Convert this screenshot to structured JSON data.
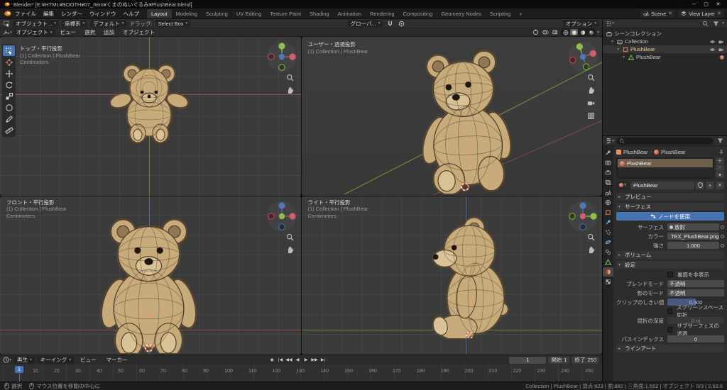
{
  "window": {
    "title": "Blender* [E:¥HTML¥BOOTH¥07_Item¥くまのぬいぐるみ¥PlushBear.blend]"
  },
  "topbar": {
    "menus": [
      "ファイル",
      "編集",
      "レンダー",
      "ウィンドウ",
      "ヘルプ"
    ],
    "workspaces": [
      "Layout",
      "Modeling",
      "Sculpting",
      "UV Editing",
      "Texture Paint",
      "Shading",
      "Animation",
      "Rendering",
      "Compositing",
      "Geometry Nodes",
      "Scripting"
    ],
    "add_workspace": "+",
    "scene": "Scene",
    "view_layer": "View Layer"
  },
  "tool_settings": {
    "mode": "オブジェクト...",
    "coord": "座標系",
    "preset": "デフォルト",
    "drag": "ドラッグ:",
    "tool": "Select Box",
    "orientation": "グローバ...",
    "options": "オプション"
  },
  "viewport_header": {
    "mode": "オブジェクト",
    "menus": [
      "ビュー",
      "選択",
      "追加",
      "オブジェクト"
    ]
  },
  "viewports": {
    "top": {
      "name": "トップ・平行投影",
      "path": "(1) Collection | PlushBear",
      "units": "Centimeters"
    },
    "user": {
      "name": "ユーザー・透視投影",
      "path": "(1) Collection | PlushBear"
    },
    "front": {
      "name": "フロント・平行投影",
      "path": "(1) Collection | PlushBear",
      "units": "Centimeters"
    },
    "right": {
      "name": "ライト・平行投影",
      "path": "(1) Collection | PlushBear",
      "units": "Centimeters"
    }
  },
  "outliner": {
    "rows": [
      {
        "label": "シーンコレクション"
      },
      {
        "label": "Collection"
      },
      {
        "label": "PlushBear"
      },
      {
        "label": "PlushBear"
      }
    ]
  },
  "properties": {
    "breadcrumb": {
      "object": "PlushBear",
      "material": "PlushBear"
    },
    "slot": "PlushBear",
    "datablock": "PlushBear",
    "panels": {
      "preview": "プレビュー",
      "surface": "サーフェス",
      "volume": "ボリューム",
      "settings": "設定",
      "line_art": "ラインアート"
    },
    "surface": {
      "use_nodes": "ノードを使用",
      "surface_label": "サーフェス",
      "surface_value": "放射",
      "color_label": "カラー",
      "color_value": "TEX_PlushBear.png",
      "strength_label": "強さ",
      "strength_value": "1.000"
    },
    "settings": {
      "backface": "裏面を非表示",
      "blend_label": "ブレンドモード",
      "blend_value": "不透明",
      "shadow_label": "影のモード",
      "shadow_value": "不透明",
      "clip_label": "クリップのしきい値",
      "clip_value": "0.500",
      "ssr": "スクリーンスペース屈折",
      "depth_label": "屈折の深度",
      "depth_value": "0 m",
      "sss": "サブサーフェスの透過",
      "pass_label": "パスインデックス",
      "pass_value": "0"
    }
  },
  "timeline": {
    "menus": [
      "再生",
      "キーイング",
      "ビュー",
      "マーカー"
    ],
    "frame": "1",
    "start_label": "開始",
    "start": "1",
    "end_label": "終了",
    "end": "250",
    "ticks": [
      "1",
      "10",
      "20",
      "30",
      "40",
      "50",
      "60",
      "70",
      "80",
      "90",
      "100",
      "110",
      "120",
      "130",
      "140",
      "150",
      "160",
      "170",
      "180",
      "190",
      "200",
      "210",
      "220",
      "230",
      "240",
      "250"
    ]
  },
  "statusbar": {
    "hint_select": "選択",
    "hint_pan": "マウス位置を移動の中心に",
    "info": "Collection | PlushBear | 頂点:823 | 面:882 | 三角面:1,552 | オブジェクト 0/3 | 2.93.6"
  }
}
